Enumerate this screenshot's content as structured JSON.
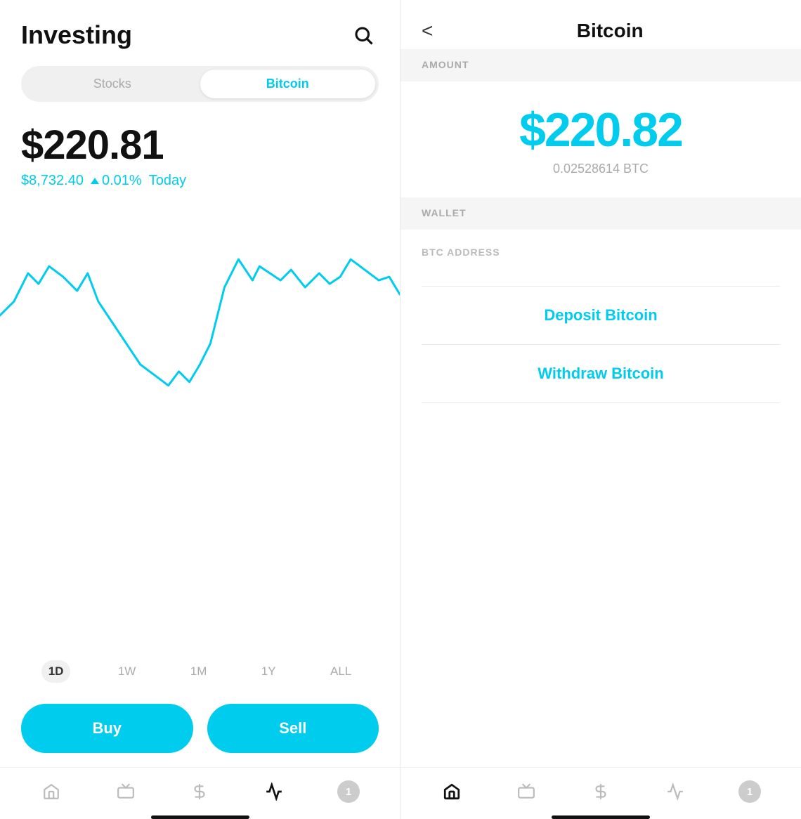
{
  "left": {
    "title": "Investing",
    "tabs": [
      {
        "id": "stocks",
        "label": "Stocks",
        "active": false
      },
      {
        "id": "bitcoin",
        "label": "Bitcoin",
        "active": true
      }
    ],
    "main_price": "$220.81",
    "btc_market_price": "$8,732.40",
    "change_pct": "0.01%",
    "period_label": "Today",
    "time_filters": [
      "1D",
      "1W",
      "1M",
      "1Y",
      "ALL"
    ],
    "active_filter": "1D",
    "buy_label": "Buy",
    "sell_label": "Sell",
    "nav_items": [
      {
        "id": "home",
        "icon": "home-icon",
        "active": false
      },
      {
        "id": "tv",
        "icon": "tv-icon",
        "active": false
      },
      {
        "id": "dollar",
        "icon": "dollar-icon",
        "active": false
      },
      {
        "id": "activity",
        "icon": "activity-icon",
        "active": true
      },
      {
        "id": "notifications",
        "icon": "bell-icon",
        "badge": "1",
        "active": false
      }
    ]
  },
  "right": {
    "title": "Bitcoin",
    "back_label": "<",
    "amount_label": "AMOUNT",
    "amount_usd": "$220.82",
    "amount_btc": "0.02528614 BTC",
    "wallet_label": "WALLET",
    "btc_address_label": "BTC ADDRESS",
    "deposit_label": "Deposit Bitcoin",
    "withdraw_label": "Withdraw Bitcoin",
    "nav_items": [
      {
        "id": "home",
        "icon": "home-icon",
        "active": true
      },
      {
        "id": "tv",
        "icon": "tv-icon",
        "active": false
      },
      {
        "id": "dollar",
        "icon": "dollar-icon",
        "active": false
      },
      {
        "id": "activity",
        "icon": "activity-icon",
        "active": false
      },
      {
        "id": "notifications",
        "icon": "bell-icon",
        "badge": "1",
        "active": false
      }
    ]
  }
}
